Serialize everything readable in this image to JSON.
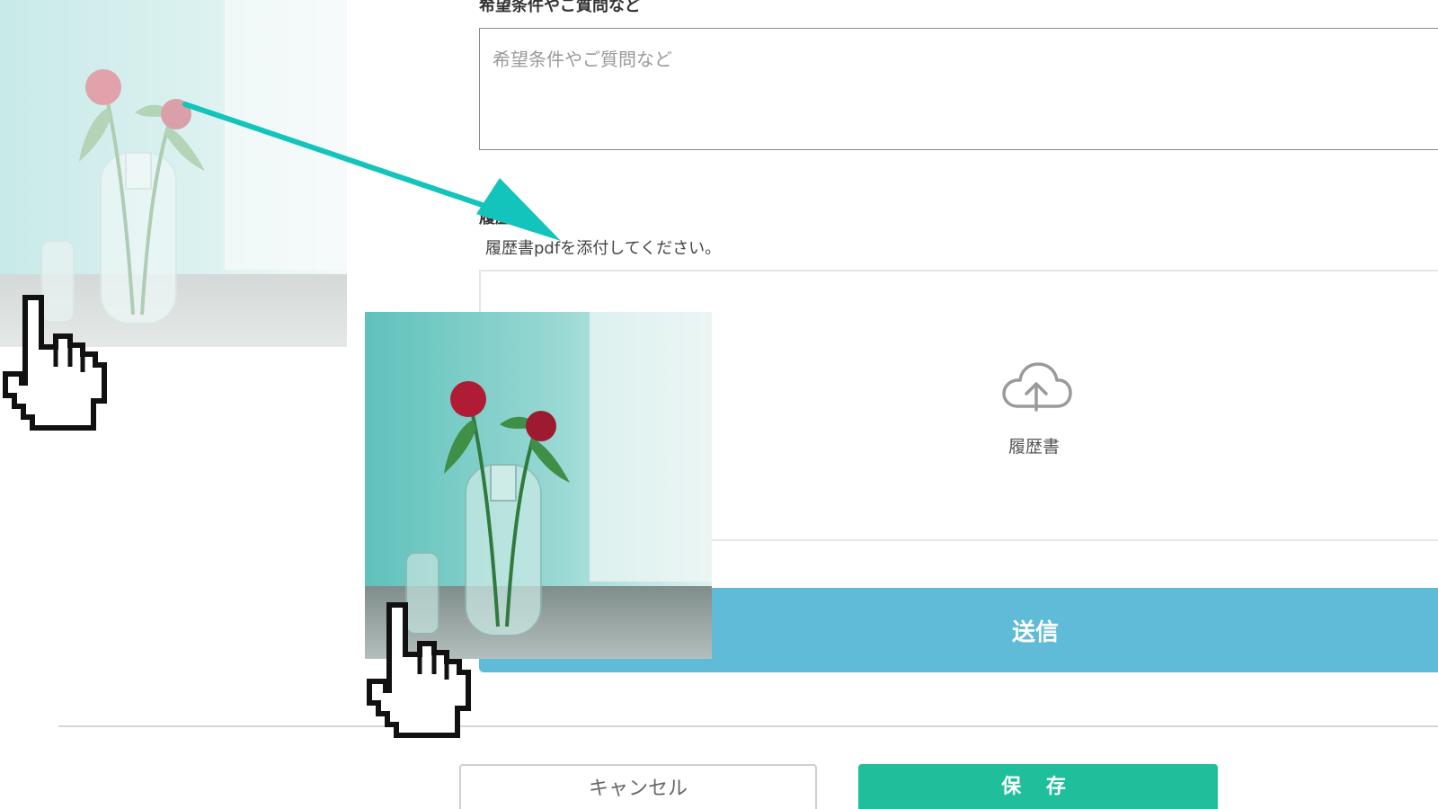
{
  "form": {
    "request_label": "希望条件やご質問など",
    "request_placeholder": "希望条件やご質問など",
    "resume_label": "履歴書",
    "resume_help": "履歴書pdfを添付してください。",
    "dropzone_label": "履歴書",
    "dropzone_icon": "cloud-upload-icon",
    "submit_label": "送信"
  },
  "footer": {
    "cancel_label": "キャンセル",
    "save_label": "保 存"
  },
  "drag_operation": {
    "image": "flower-vase-photo",
    "arrow_color": "#12c4bc",
    "cursor": "hand-pointer-icon"
  },
  "colors": {
    "submit": "#5fbbd7",
    "save": "#1fbf9c",
    "arrow": "#12c4bc"
  }
}
